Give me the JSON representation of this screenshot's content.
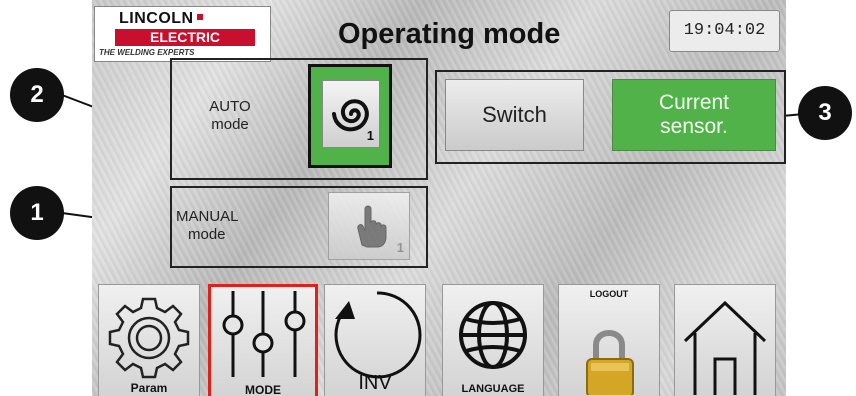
{
  "header": {
    "logo": {
      "brand_top": "LINCOLN",
      "brand_bottom": "ELECTRIC",
      "tagline": "THE WELDING EXPERTS"
    },
    "title": "Operating mode",
    "clock": "19:04:02"
  },
  "auto_panel": {
    "label_line1": "AUTO",
    "label_line2": "mode",
    "button_sub": "1",
    "icon": "spiral-icon",
    "selected": true
  },
  "manual_panel": {
    "label_line1": "MANUAL",
    "label_line2": "mode",
    "button_sub": "1",
    "icon": "hand-pointer-icon",
    "selected": false
  },
  "sensor_panel": {
    "switch_label": "Switch",
    "current_label_line1": "Current",
    "current_label_line2": "sensor.",
    "selected": "current"
  },
  "nav": {
    "param_label": "Param",
    "mode_label": "MODE",
    "inv_label": "INV",
    "language_label": "LANGUAGE",
    "logout_label": "LOGOUT",
    "active": "MODE"
  },
  "callouts": [
    "1",
    "2",
    "3"
  ],
  "colors": {
    "active_green": "#52b24a",
    "selected_border": "#e0211b",
    "brand_red": "#c8102e"
  }
}
